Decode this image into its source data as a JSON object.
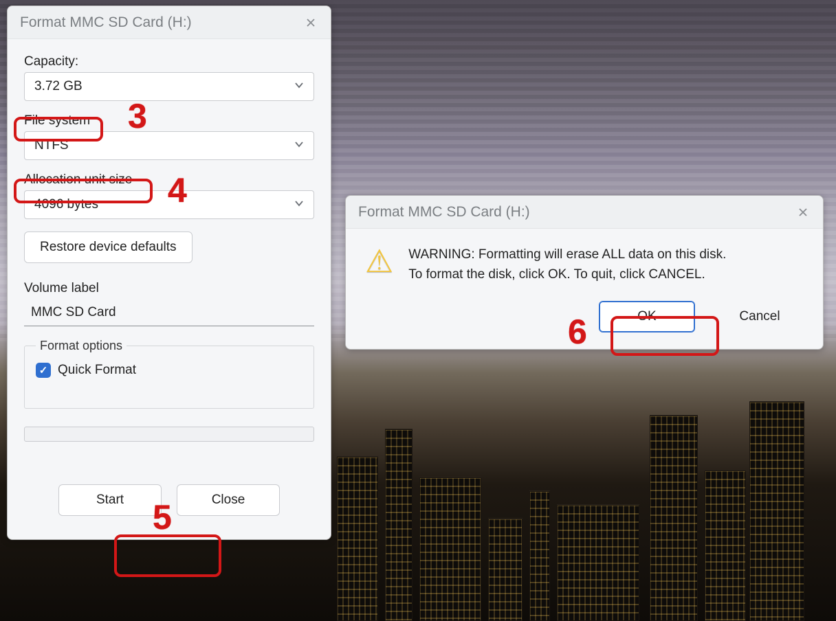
{
  "formatDialog": {
    "title": "Format MMC SD Card (H:)",
    "labels": {
      "capacity": "Capacity:",
      "fileSystem": "File system",
      "allocation": "Allocation unit size",
      "volumeLabel": "Volume label",
      "formatOptions": "Format options",
      "quickFormat": "Quick Format"
    },
    "values": {
      "capacity": "3.72 GB",
      "fileSystem": "NTFS",
      "allocation": "4096 bytes",
      "volume": "MMC SD Card",
      "quickFormat": true
    },
    "buttons": {
      "restoreDefaults": "Restore device defaults",
      "start": "Start",
      "close": "Close"
    }
  },
  "warningDialog": {
    "title": "Format MMC SD Card (H:)",
    "message": "WARNING: Formatting will erase ALL data on this disk.\nTo format the disk, click OK. To quit, click CANCEL.",
    "buttons": {
      "ok": "OK",
      "cancel": "Cancel"
    }
  },
  "annotations": {
    "n3": "3",
    "n4": "4",
    "n5": "5",
    "n6": "6"
  }
}
